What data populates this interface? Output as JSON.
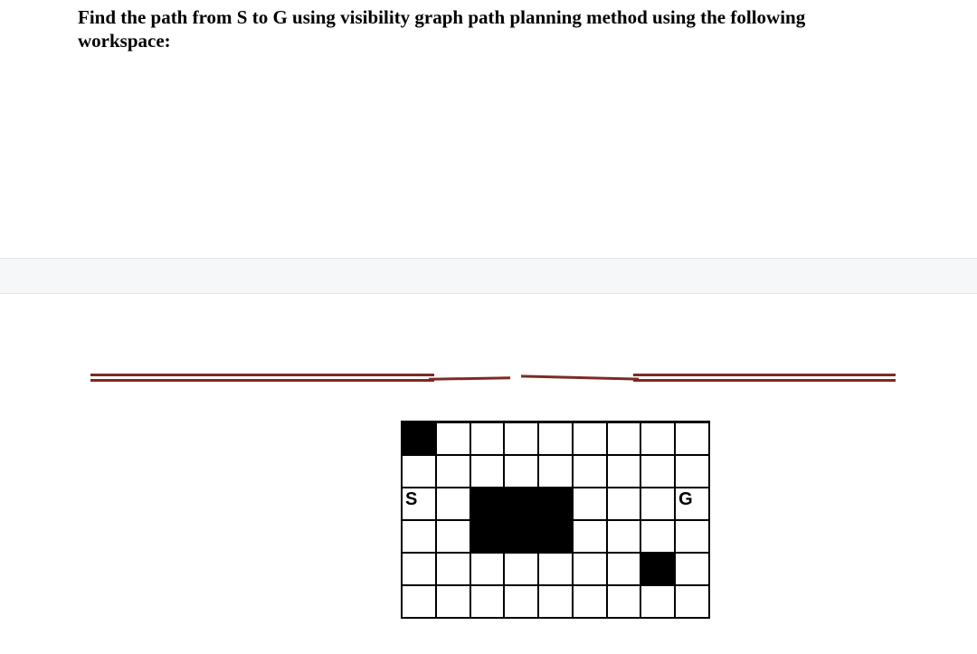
{
  "question": {
    "text_line1": "Find the path from  S to G using visibility graph path planning method  using the following",
    "text_line2": "workspace:"
  },
  "grid": {
    "rows": 6,
    "cols": 9,
    "start_label": "S",
    "goal_label": "G",
    "cells": [
      [
        {
          "t": "obs"
        },
        {
          "t": "emp"
        },
        {
          "t": "emp"
        },
        {
          "t": "emp"
        },
        {
          "t": "emp"
        },
        {
          "t": "emp"
        },
        {
          "t": "emp"
        },
        {
          "t": "emp"
        },
        {
          "t": "emp"
        }
      ],
      [
        {
          "t": "emp"
        },
        {
          "t": "emp"
        },
        {
          "t": "emp"
        },
        {
          "t": "emp"
        },
        {
          "t": "emp"
        },
        {
          "t": "emp"
        },
        {
          "t": "emp"
        },
        {
          "t": "emp"
        },
        {
          "t": "emp"
        }
      ],
      [
        {
          "t": "lbl",
          "k": "S"
        },
        {
          "t": "emp"
        },
        {
          "t": "obs"
        },
        {
          "t": "obs"
        },
        {
          "t": "obs"
        },
        {
          "t": "emp"
        },
        {
          "t": "emp"
        },
        {
          "t": "emp"
        },
        {
          "t": "lbl",
          "k": "G"
        }
      ],
      [
        {
          "t": "emp"
        },
        {
          "t": "emp"
        },
        {
          "t": "obs"
        },
        {
          "t": "obs"
        },
        {
          "t": "obs"
        },
        {
          "t": "emp"
        },
        {
          "t": "emp"
        },
        {
          "t": "emp"
        },
        {
          "t": "emp"
        }
      ],
      [
        {
          "t": "emp"
        },
        {
          "t": "emp"
        },
        {
          "t": "emp"
        },
        {
          "t": "emp"
        },
        {
          "t": "emp"
        },
        {
          "t": "emp"
        },
        {
          "t": "emp"
        },
        {
          "t": "obs"
        },
        {
          "t": "emp"
        }
      ],
      [
        {
          "t": "emp"
        },
        {
          "t": "emp"
        },
        {
          "t": "emp"
        },
        {
          "t": "emp"
        },
        {
          "t": "emp"
        },
        {
          "t": "emp"
        },
        {
          "t": "emp"
        },
        {
          "t": "emp"
        },
        {
          "t": "emp"
        }
      ]
    ]
  }
}
